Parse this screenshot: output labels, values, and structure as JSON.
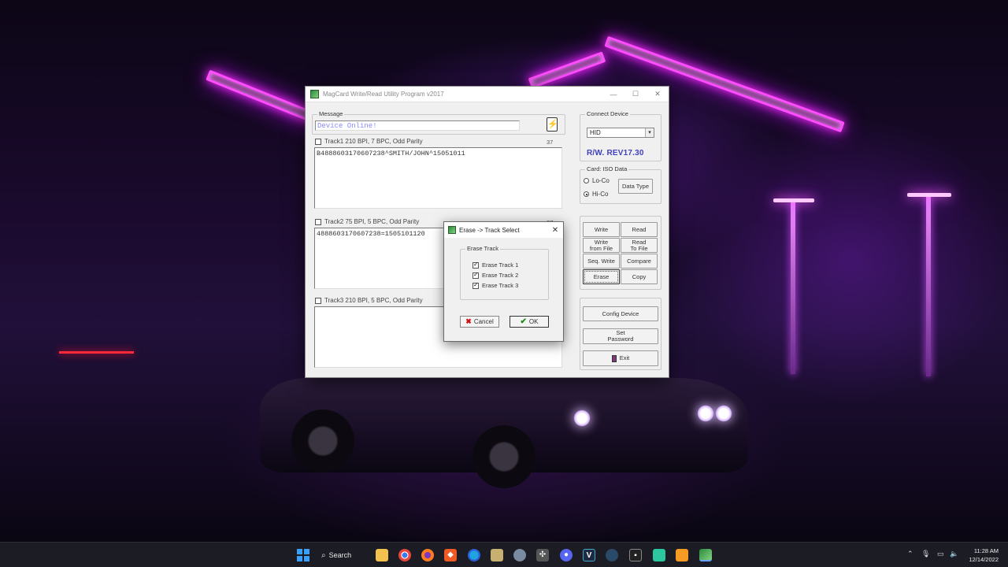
{
  "app": {
    "title": "MagCard Write/Read Utility Program  v2017",
    "minimize": "—",
    "maximize": "☐",
    "close": "✕",
    "message_label": "Message",
    "message_value": "Device Online!",
    "battery_icon": "battery-charging-icon",
    "tracks": [
      {
        "label": "Track1   210 BPI, 7 BPC, Odd Parity",
        "count": "37",
        "value": "B4888603170607238^SMITH/JOHN^15051011"
      },
      {
        "label": "Track2   75 BPI, 5 BPC, Odd Parity",
        "count": "37",
        "value": "4888603170607238=1505101120"
      },
      {
        "label": "Track3   210 BPI, 5 BPC, Odd Parity",
        "count": "",
        "value": ""
      }
    ],
    "connect_device_label": "Connect Device",
    "connect_device_value": "HID",
    "version": "R/W. REV17.30",
    "card_label": "Card: ISO Data",
    "lo_co": "Lo-Co",
    "hi_co": "Hi-Co",
    "data_type_button": "Data Type",
    "buttons": {
      "write": "Write",
      "read": "Read",
      "write_from_file": "Write\nfrom File",
      "read_to_file": "Read\nTo File",
      "seq_write": "Seq. Write",
      "compare": "Compare",
      "erase": "Erase",
      "copy": "Copy",
      "config_device": "Config Device",
      "set_password": "Set\nPassword",
      "exit": "Exit"
    }
  },
  "dialog": {
    "title": "Erase -> Track Select",
    "group_label": "Erase Track",
    "options": [
      {
        "label": "Erase Track 1",
        "checked": true
      },
      {
        "label": "Erase Track 2",
        "checked": true
      },
      {
        "label": "Erase Track 3",
        "checked": true
      }
    ],
    "cancel": "Cancel",
    "ok": "OK",
    "close": "✕"
  },
  "taskbar": {
    "search_label": "Search",
    "time": "11:28 AM",
    "date": "12/14/2022",
    "icons": [
      "windows-start-icon",
      "search-icon",
      "file-explorer-icon",
      "chrome-icon",
      "firefox-icon",
      "brave-icon",
      "edge-icon",
      "app-icon",
      "browser-icon",
      "tool-icon",
      "discord-icon",
      "vim-icon",
      "steam-icon",
      "terminal-icon",
      "app-icon-2",
      "sublime-icon",
      "magcard-icon"
    ],
    "tray_icons": [
      "chevron-up-icon",
      "microphone-icon",
      "network-icon",
      "volume-icon"
    ]
  }
}
